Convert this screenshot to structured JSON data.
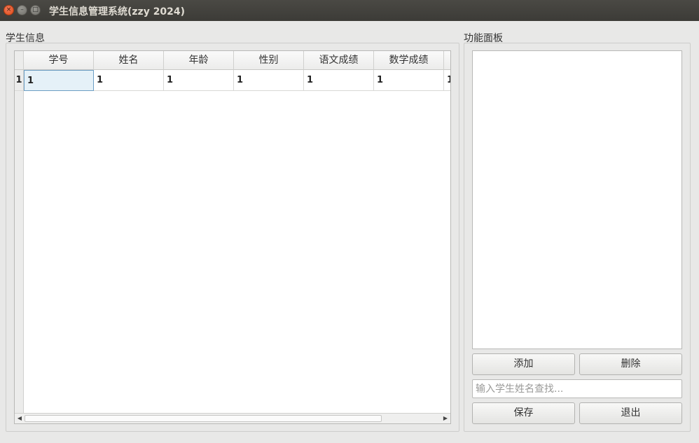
{
  "window": {
    "title": "学生信息管理系统(zzy 2024)",
    "close_glyph": "×",
    "min_glyph": "–",
    "max_glyph": "□"
  },
  "student_group": {
    "label": "学生信息",
    "table": {
      "headers": [
        "学号",
        "姓名",
        "年龄",
        "性别",
        "语文成绩",
        "数学成绩",
        ""
      ],
      "rows": [
        {
          "row_header": "1",
          "cells": [
            "1",
            "1",
            "1",
            "1",
            "1",
            "1",
            "1"
          ]
        }
      ],
      "selected_cell": {
        "row": 0,
        "col": 0
      }
    },
    "scroll_left_glyph": "◀",
    "scroll_right_glyph": "▶"
  },
  "function_group": {
    "label": "功能面板",
    "add_label": "添加",
    "delete_label": "删除",
    "search_placeholder": "输入学生姓名查找...",
    "save_label": "保存",
    "exit_label": "退出"
  },
  "colors": {
    "titlebar": "#3c3b37",
    "close_button": "#df4a16",
    "window_bg": "#e8e8e7",
    "selection": "#e5f1f8"
  },
  "icons": {
    "close": "close-icon",
    "minimize": "minimize-icon",
    "maximize": "maximize-icon"
  }
}
